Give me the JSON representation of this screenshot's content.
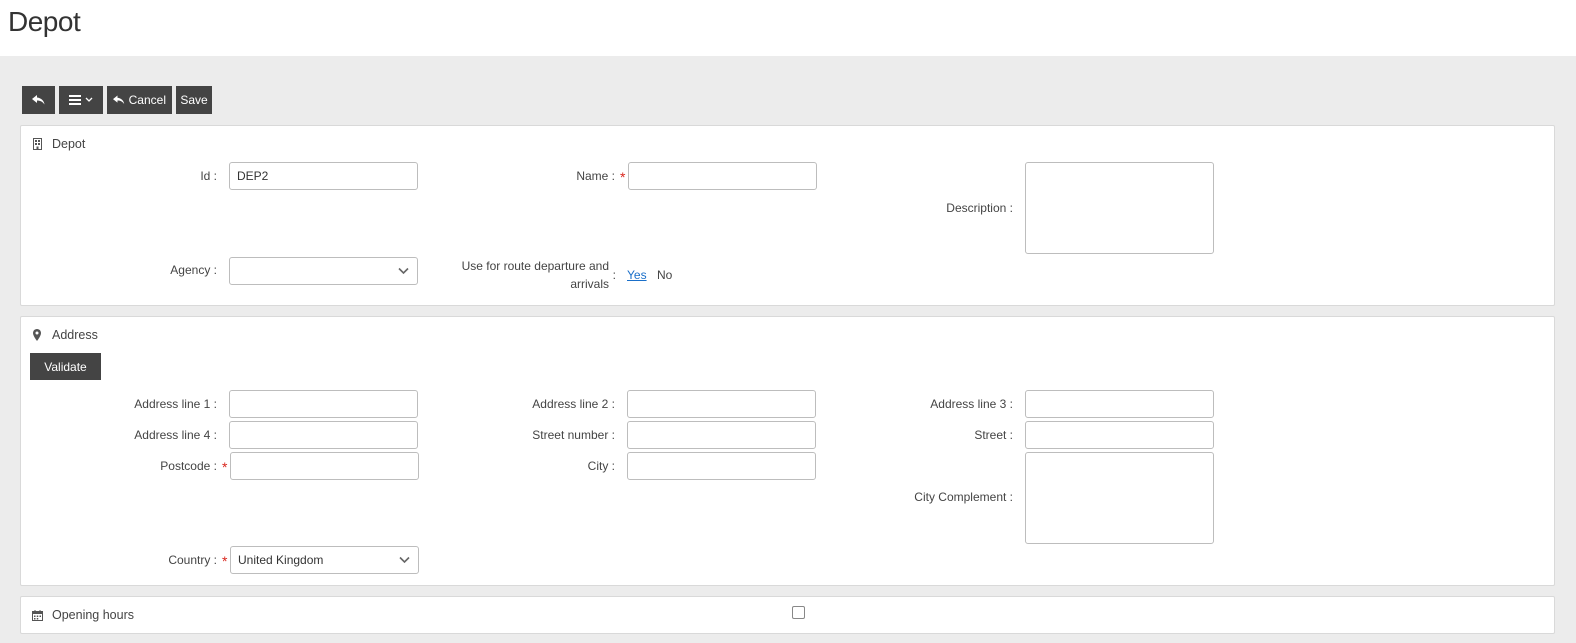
{
  "page": {
    "title": "Depot"
  },
  "toolbar": {
    "cancel_label": "Cancel",
    "save_label": "Save"
  },
  "depot_section": {
    "heading": "Depot",
    "id_label": "Id :",
    "id_value": "DEP2",
    "name_label": "Name :",
    "name_value": "",
    "description_label": "Description :",
    "description_value": "",
    "agency_label": "Agency :",
    "agency_value": "",
    "route_label_line1": "Use for route departure and",
    "route_label_line2": "arrivals",
    "route_colon": ":",
    "route_yes": "Yes",
    "route_no": "No"
  },
  "address_section": {
    "heading": "Address",
    "validate_label": "Validate",
    "line1_label": "Address line 1 :",
    "line2_label": "Address line 2 :",
    "line3_label": "Address line 3 :",
    "line4_label": "Address line 4 :",
    "street_number_label": "Street number :",
    "street_label": "Street :",
    "postcode_label": "Postcode :",
    "city_label": "City :",
    "city_complement_label": "City Complement :",
    "country_label": "Country :",
    "country_value": "United Kingdom"
  },
  "hours_section": {
    "heading": "Opening hours",
    "enabled": false
  },
  "colors": {
    "accent_dark": "#444444",
    "required": "#d9251c",
    "link": "#1a6fc9"
  }
}
